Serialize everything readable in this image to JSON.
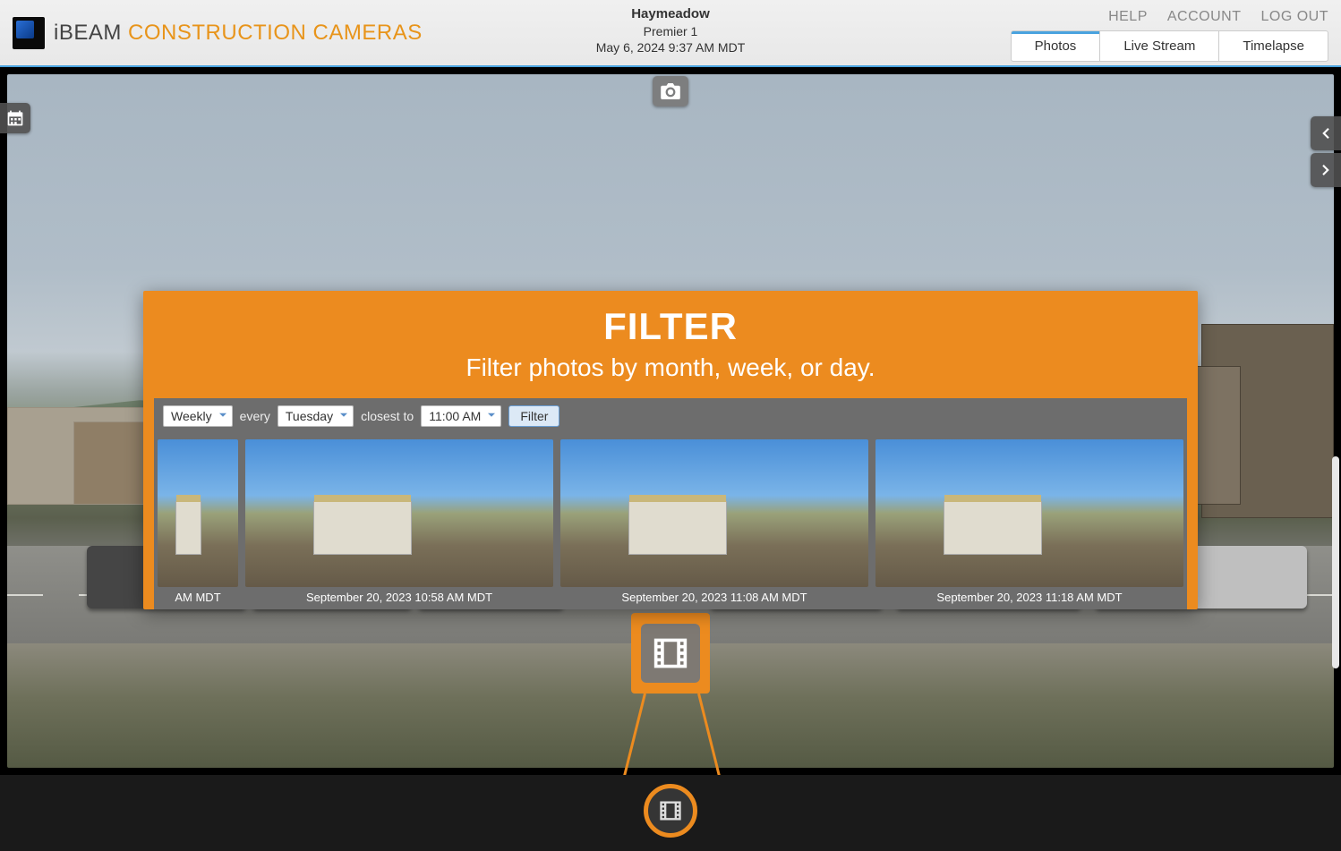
{
  "brand": {
    "part1": "iBEAM",
    "part2": " CONSTRUCTION CAMERAS"
  },
  "header": {
    "project": "Haymeadow",
    "camera": "Premier 1",
    "timestamp": "May 6, 2024 9:37 AM MDT"
  },
  "nav": {
    "help": "HELP",
    "account": "ACCOUNT",
    "logout": "LOG OUT",
    "tabs": {
      "photos": "Photos",
      "live": "Live Stream",
      "timelapse": "Timelapse"
    }
  },
  "callout": {
    "title": "FILTER",
    "subtitle": "Filter photos by month, week, or day."
  },
  "filter": {
    "frequency": "Weekly",
    "every_label": "every",
    "day": "Tuesday",
    "closest_label": "closest to",
    "time": "11:00 AM",
    "button": "Filter"
  },
  "thumbs": [
    {
      "label": "AM MDT"
    },
    {
      "label": "September 20, 2023 10:58 AM MDT"
    },
    {
      "label": "September 20, 2023 11:08 AM MDT"
    },
    {
      "label": "September 20, 2023 11:18 AM MDT"
    }
  ]
}
